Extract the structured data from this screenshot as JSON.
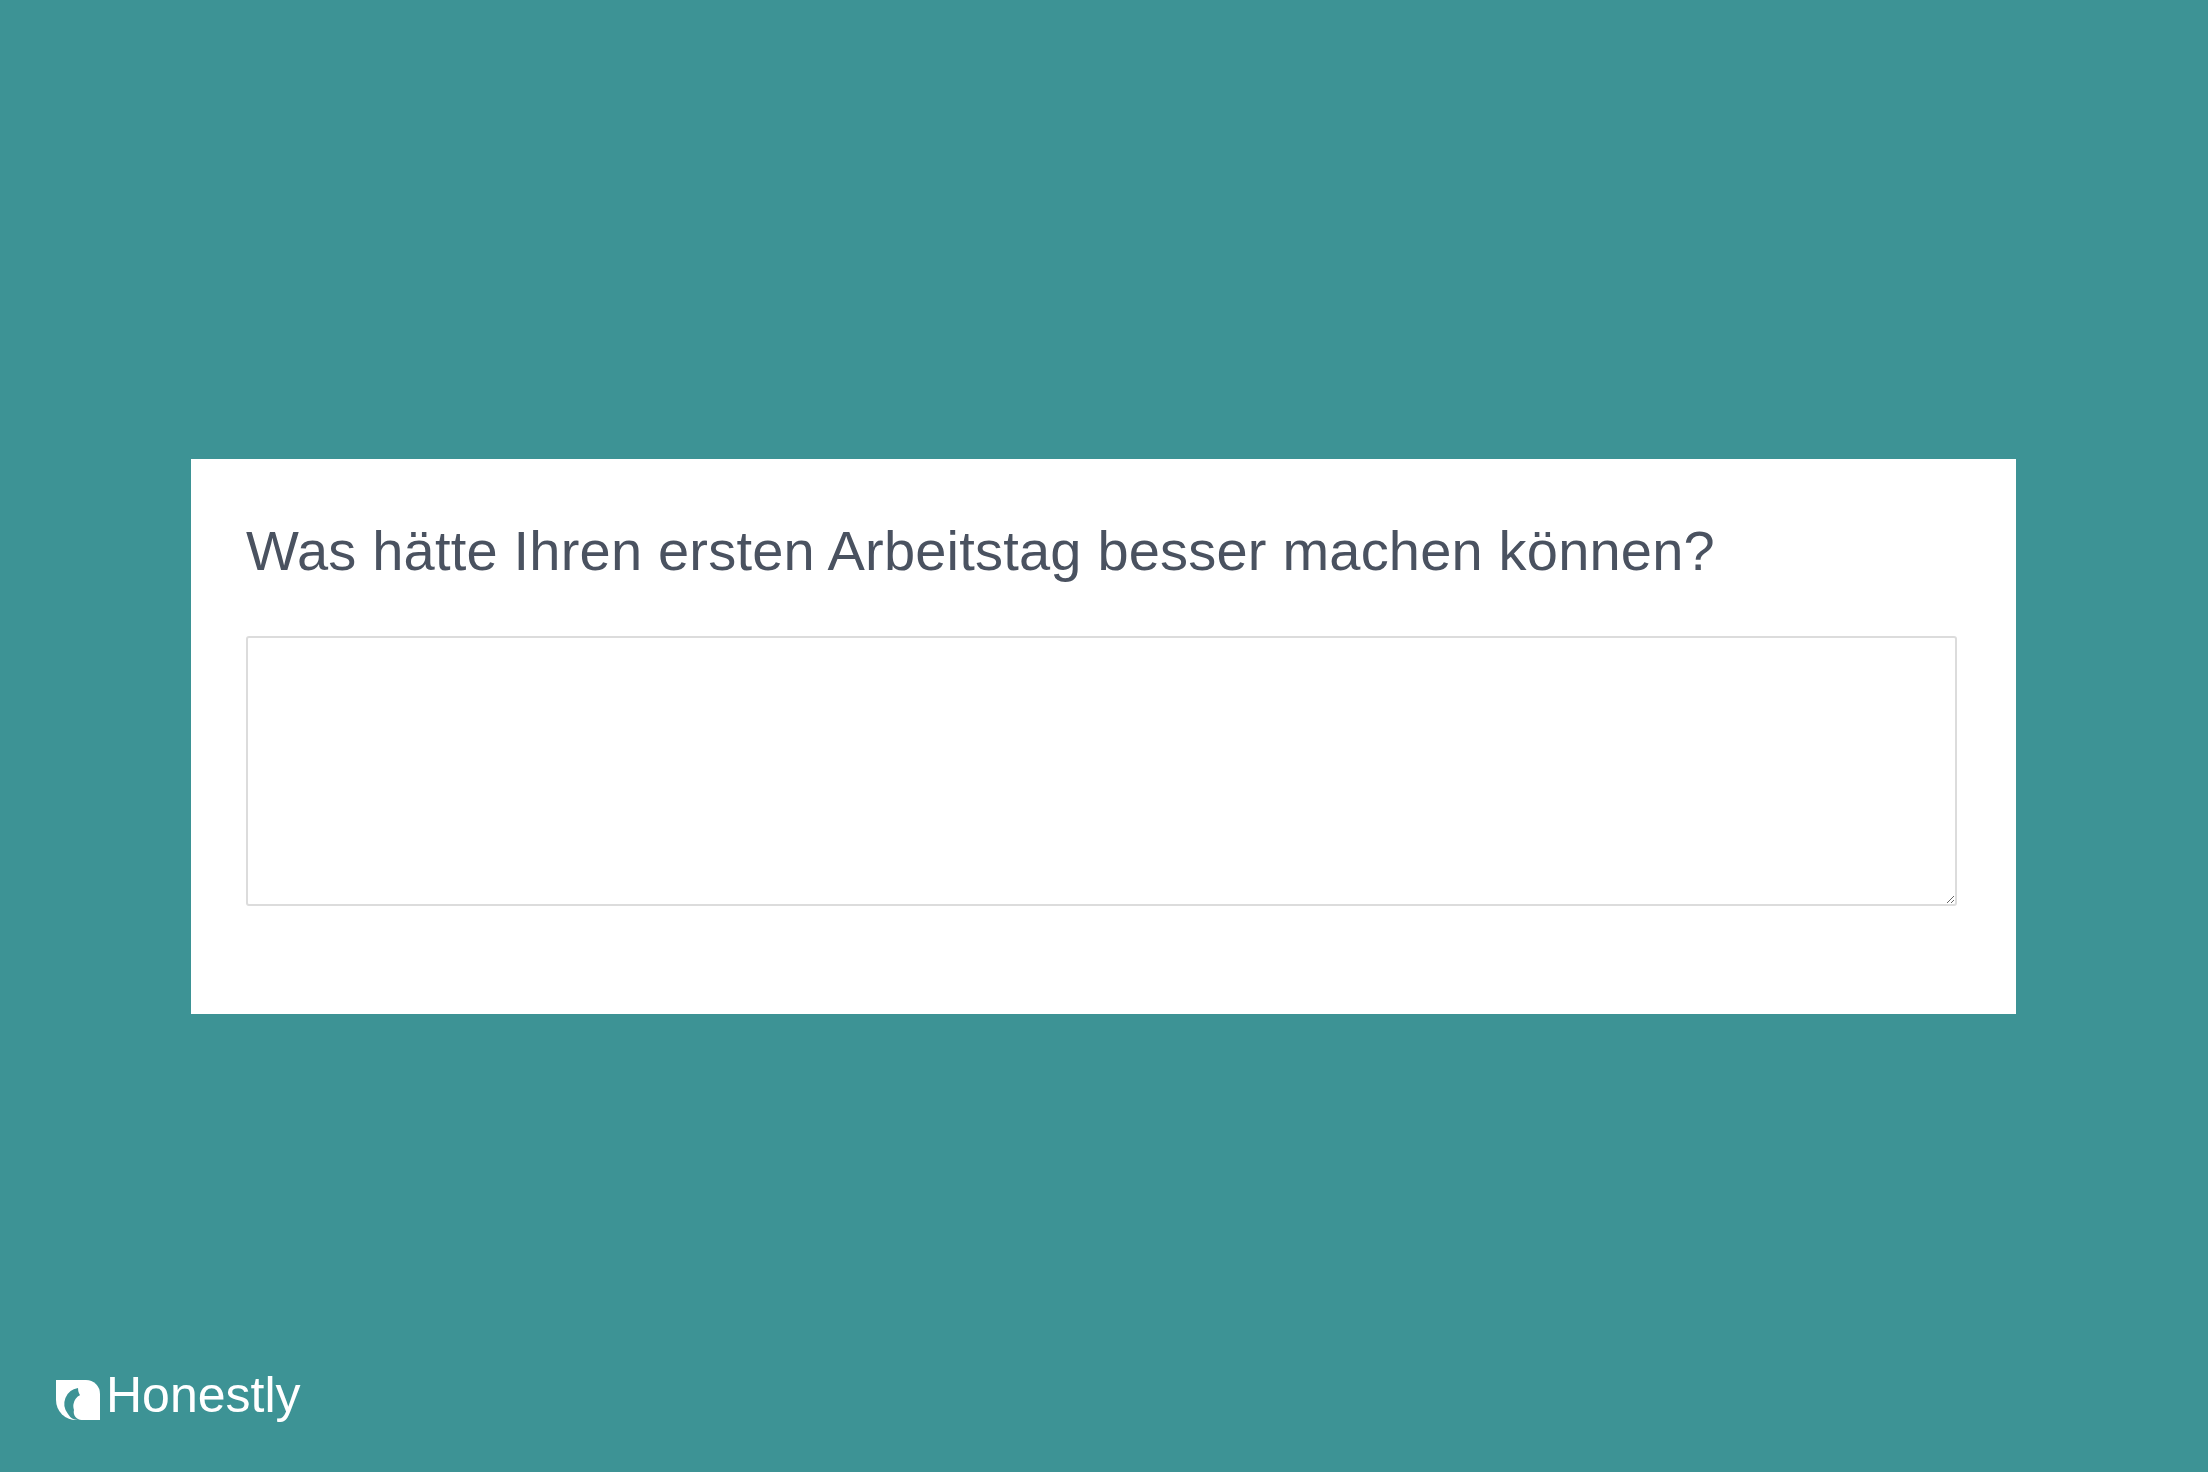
{
  "card": {
    "question": "Was hätte Ihren ersten Arbeitstag besser machen können?",
    "answer_field": {
      "kind": "textarea"
    }
  },
  "brand": {
    "name": "Honestly"
  }
}
